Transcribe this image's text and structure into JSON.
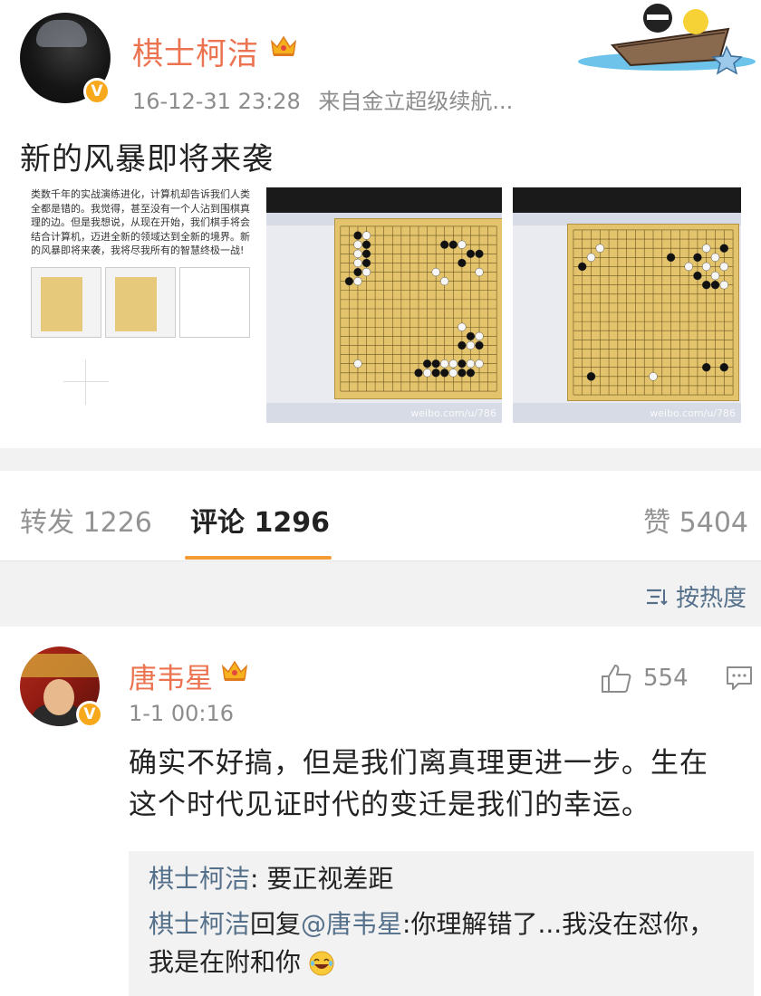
{
  "post": {
    "username": "棋士柯洁",
    "verified_badge": "V",
    "timestamp": "16-12-31 23:28",
    "source": "来自金立超级续航...",
    "text": "新的风暴即将来袭",
    "image_1_text": "类数千年的实战演练进化，计算机却告诉我们人类全都是错的。我觉得，甚至没有一个人沾到围棋真理的边。但是我想说，从现在开始，我们棋手将会结合计算机，迈进全新的领域达到全新的境界。新的风暴即将来袭，我将尽我所有的智慧终极一战!",
    "image_watermark": "weibo.com/u/786",
    "image_watermark_3": "weibo.com/u/786"
  },
  "tabs": {
    "repost_label": "转发",
    "repost_count": "1226",
    "comment_label": "评论",
    "comment_count": "1296",
    "like_label": "赞",
    "like_count": "5404"
  },
  "sort": {
    "label": "按热度"
  },
  "comment": {
    "username": "唐韦星",
    "verified_badge": "V",
    "time": "1-1 00:16",
    "like_count": "554",
    "text": "确实不好搞，但是我们离真理更进一步。生在这个时代见证时代的变迁是我们的幸运。",
    "replies": [
      {
        "name": "棋士柯洁",
        "separator": ": ",
        "text": "要正视差距"
      },
      {
        "name": "棋士柯洁",
        "reply_word": "回复",
        "mention": "@唐韦星",
        "separator": ":",
        "text": "你理解错了...我没在怼你，我是在附和你"
      }
    ]
  },
  "colors": {
    "username": "#eb7350",
    "link": "#55708a",
    "tab_indicator": "#f29c36",
    "badge": "#f7a81b",
    "muted": "#8c8c8c"
  },
  "icons": [
    "crown-icon",
    "verified-icon",
    "sort-icon",
    "thumbs-up-icon",
    "reply-comment-icon",
    "laughing-emoji-icon"
  ]
}
